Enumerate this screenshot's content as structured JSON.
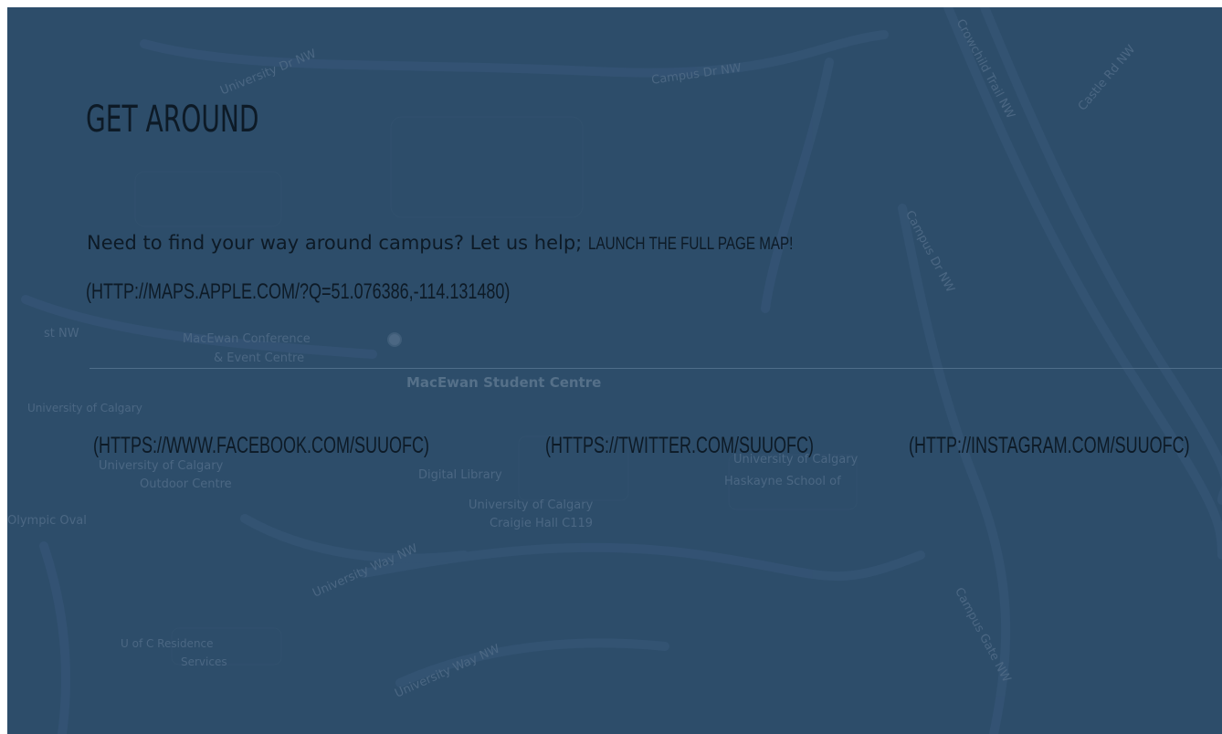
{
  "section": {
    "title": "GET AROUND",
    "intro_text": "Need to find your way around campus? Let us help;",
    "map_link_label": "LAUNCH THE FULL PAGE MAP!",
    "map_link_url": "(HTTP://MAPS.APPLE.COM/?Q=51.076386,-114.131480)"
  },
  "social_links": [
    {
      "label": "(HTTPS://WWW.FACEBOOK.COM/SUUOFC)"
    },
    {
      "label": "(HTTPS://TWITTER.COM/SUUOFC)"
    },
    {
      "label": "(HTTP://INSTAGRAM.COM/SUUOFC)"
    }
  ],
  "map": {
    "labels": {
      "campus_dr_top": "Campus Dr NW",
      "university_dr": "University Dr NW",
      "macewan_conference": "MacEwan Conference",
      "event_centre": "& Event Centre",
      "macewan_student_centre": "MacEwan Student Centre",
      "university_of_calgary": "University of Calgary",
      "outdoor_centre_1": "University of Calgary",
      "outdoor_centre_2": "Outdoor Centre",
      "digital_library": "Digital Library",
      "craigie_hall_1": "University of Calgary",
      "craigie_hall_2": "Craigie Hall C119",
      "haskayne_1": "University of Calgary",
      "haskayne_2": "Haskayne School of",
      "olympic_oval": "Olympic Oval",
      "u_of_c_residence_1": "U of C Residence",
      "u_of_c_residence_2": "Services",
      "university_way": "University Way NW",
      "university_way_2": "University Way NW",
      "crowchild": "Crowchild Trail NW",
      "campus_dr_right": "Campus Dr NW",
      "campus_gate": "Campus Gate NW",
      "castle_rd": "Castle Rd NW",
      "west_st": "st NW"
    },
    "colors": {
      "overlay": "#2d4d6a",
      "road": "#3a5a78",
      "label": "#4b6783"
    }
  }
}
